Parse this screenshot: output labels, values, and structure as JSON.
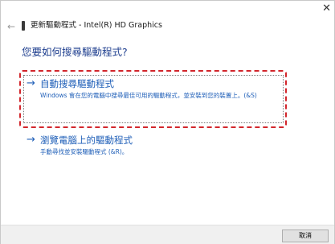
{
  "window": {
    "title": "更新驅動程式 - Intel(R) HD Graphics",
    "close_glyph": "✕",
    "back_glyph": "←"
  },
  "main": {
    "heading": "您要如何搜尋驅動程式?",
    "options": [
      {
        "arrow": "→",
        "title": "自動搜尋驅動程式",
        "description": "Windows 會在您的電腦中搜尋最佳可用的驅動程式，並安裝到您的裝置上。(&S)"
      },
      {
        "arrow": "→",
        "title": "瀏覽電腦上的驅動程式",
        "description": "手動尋找並安裝驅動程式 (&R)。"
      }
    ]
  },
  "footer": {
    "cancel_label": "取消"
  },
  "colors": {
    "link_blue": "#1f5fb8",
    "heading_blue": "#1f3f8f",
    "highlight_red": "#d2262c"
  }
}
